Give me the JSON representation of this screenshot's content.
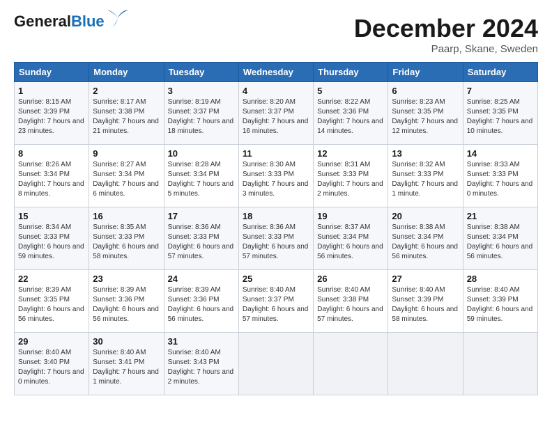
{
  "header": {
    "logo_general": "General",
    "logo_blue": "Blue",
    "month_title": "December 2024",
    "location": "Paarp, Skane, Sweden"
  },
  "weekdays": [
    "Sunday",
    "Monday",
    "Tuesday",
    "Wednesday",
    "Thursday",
    "Friday",
    "Saturday"
  ],
  "weeks": [
    [
      {
        "day": "1",
        "sunrise": "Sunrise: 8:15 AM",
        "sunset": "Sunset: 3:39 PM",
        "daylight": "Daylight: 7 hours and 23 minutes."
      },
      {
        "day": "2",
        "sunrise": "Sunrise: 8:17 AM",
        "sunset": "Sunset: 3:38 PM",
        "daylight": "Daylight: 7 hours and 21 minutes."
      },
      {
        "day": "3",
        "sunrise": "Sunrise: 8:19 AM",
        "sunset": "Sunset: 3:37 PM",
        "daylight": "Daylight: 7 hours and 18 minutes."
      },
      {
        "day": "4",
        "sunrise": "Sunrise: 8:20 AM",
        "sunset": "Sunset: 3:37 PM",
        "daylight": "Daylight: 7 hours and 16 minutes."
      },
      {
        "day": "5",
        "sunrise": "Sunrise: 8:22 AM",
        "sunset": "Sunset: 3:36 PM",
        "daylight": "Daylight: 7 hours and 14 minutes."
      },
      {
        "day": "6",
        "sunrise": "Sunrise: 8:23 AM",
        "sunset": "Sunset: 3:35 PM",
        "daylight": "Daylight: 7 hours and 12 minutes."
      },
      {
        "day": "7",
        "sunrise": "Sunrise: 8:25 AM",
        "sunset": "Sunset: 3:35 PM",
        "daylight": "Daylight: 7 hours and 10 minutes."
      }
    ],
    [
      {
        "day": "8",
        "sunrise": "Sunrise: 8:26 AM",
        "sunset": "Sunset: 3:34 PM",
        "daylight": "Daylight: 7 hours and 8 minutes."
      },
      {
        "day": "9",
        "sunrise": "Sunrise: 8:27 AM",
        "sunset": "Sunset: 3:34 PM",
        "daylight": "Daylight: 7 hours and 6 minutes."
      },
      {
        "day": "10",
        "sunrise": "Sunrise: 8:28 AM",
        "sunset": "Sunset: 3:34 PM",
        "daylight": "Daylight: 7 hours and 5 minutes."
      },
      {
        "day": "11",
        "sunrise": "Sunrise: 8:30 AM",
        "sunset": "Sunset: 3:33 PM",
        "daylight": "Daylight: 7 hours and 3 minutes."
      },
      {
        "day": "12",
        "sunrise": "Sunrise: 8:31 AM",
        "sunset": "Sunset: 3:33 PM",
        "daylight": "Daylight: 7 hours and 2 minutes."
      },
      {
        "day": "13",
        "sunrise": "Sunrise: 8:32 AM",
        "sunset": "Sunset: 3:33 PM",
        "daylight": "Daylight: 7 hours and 1 minute."
      },
      {
        "day": "14",
        "sunrise": "Sunrise: 8:33 AM",
        "sunset": "Sunset: 3:33 PM",
        "daylight": "Daylight: 7 hours and 0 minutes."
      }
    ],
    [
      {
        "day": "15",
        "sunrise": "Sunrise: 8:34 AM",
        "sunset": "Sunset: 3:33 PM",
        "daylight": "Daylight: 6 hours and 59 minutes."
      },
      {
        "day": "16",
        "sunrise": "Sunrise: 8:35 AM",
        "sunset": "Sunset: 3:33 PM",
        "daylight": "Daylight: 6 hours and 58 minutes."
      },
      {
        "day": "17",
        "sunrise": "Sunrise: 8:36 AM",
        "sunset": "Sunset: 3:33 PM",
        "daylight": "Daylight: 6 hours and 57 minutes."
      },
      {
        "day": "18",
        "sunrise": "Sunrise: 8:36 AM",
        "sunset": "Sunset: 3:33 PM",
        "daylight": "Daylight: 6 hours and 57 minutes."
      },
      {
        "day": "19",
        "sunrise": "Sunrise: 8:37 AM",
        "sunset": "Sunset: 3:34 PM",
        "daylight": "Daylight: 6 hours and 56 minutes."
      },
      {
        "day": "20",
        "sunrise": "Sunrise: 8:38 AM",
        "sunset": "Sunset: 3:34 PM",
        "daylight": "Daylight: 6 hours and 56 minutes."
      },
      {
        "day": "21",
        "sunrise": "Sunrise: 8:38 AM",
        "sunset": "Sunset: 3:34 PM",
        "daylight": "Daylight: 6 hours and 56 minutes."
      }
    ],
    [
      {
        "day": "22",
        "sunrise": "Sunrise: 8:39 AM",
        "sunset": "Sunset: 3:35 PM",
        "daylight": "Daylight: 6 hours and 56 minutes."
      },
      {
        "day": "23",
        "sunrise": "Sunrise: 8:39 AM",
        "sunset": "Sunset: 3:36 PM",
        "daylight": "Daylight: 6 hours and 56 minutes."
      },
      {
        "day": "24",
        "sunrise": "Sunrise: 8:39 AM",
        "sunset": "Sunset: 3:36 PM",
        "daylight": "Daylight: 6 hours and 56 minutes."
      },
      {
        "day": "25",
        "sunrise": "Sunrise: 8:40 AM",
        "sunset": "Sunset: 3:37 PM",
        "daylight": "Daylight: 6 hours and 57 minutes."
      },
      {
        "day": "26",
        "sunrise": "Sunrise: 8:40 AM",
        "sunset": "Sunset: 3:38 PM",
        "daylight": "Daylight: 6 hours and 57 minutes."
      },
      {
        "day": "27",
        "sunrise": "Sunrise: 8:40 AM",
        "sunset": "Sunset: 3:39 PM",
        "daylight": "Daylight: 6 hours and 58 minutes."
      },
      {
        "day": "28",
        "sunrise": "Sunrise: 8:40 AM",
        "sunset": "Sunset: 3:39 PM",
        "daylight": "Daylight: 6 hours and 59 minutes."
      }
    ],
    [
      {
        "day": "29",
        "sunrise": "Sunrise: 8:40 AM",
        "sunset": "Sunset: 3:40 PM",
        "daylight": "Daylight: 7 hours and 0 minutes."
      },
      {
        "day": "30",
        "sunrise": "Sunrise: 8:40 AM",
        "sunset": "Sunset: 3:41 PM",
        "daylight": "Daylight: 7 hours and 1 minute."
      },
      {
        "day": "31",
        "sunrise": "Sunrise: 8:40 AM",
        "sunset": "Sunset: 3:43 PM",
        "daylight": "Daylight: 7 hours and 2 minutes."
      },
      null,
      null,
      null,
      null
    ]
  ]
}
